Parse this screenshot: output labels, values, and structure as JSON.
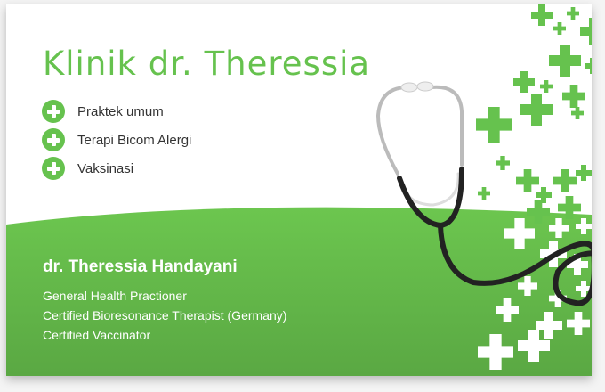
{
  "clinic_title": "Klinik dr. Theressia",
  "services": [
    "Praktek umum",
    "Terapi Bicom Alergi",
    "Vaksinasi"
  ],
  "doctor": {
    "name": "dr. Theressia Handayani",
    "credentials": [
      "General Health Practioner",
      "Certified Bioresonance Therapist (Germany)",
      "Certified Vaccinator"
    ]
  },
  "colors": {
    "brand_green": "#66c24e",
    "dark_green": "#5aa843",
    "text": "#333333"
  }
}
